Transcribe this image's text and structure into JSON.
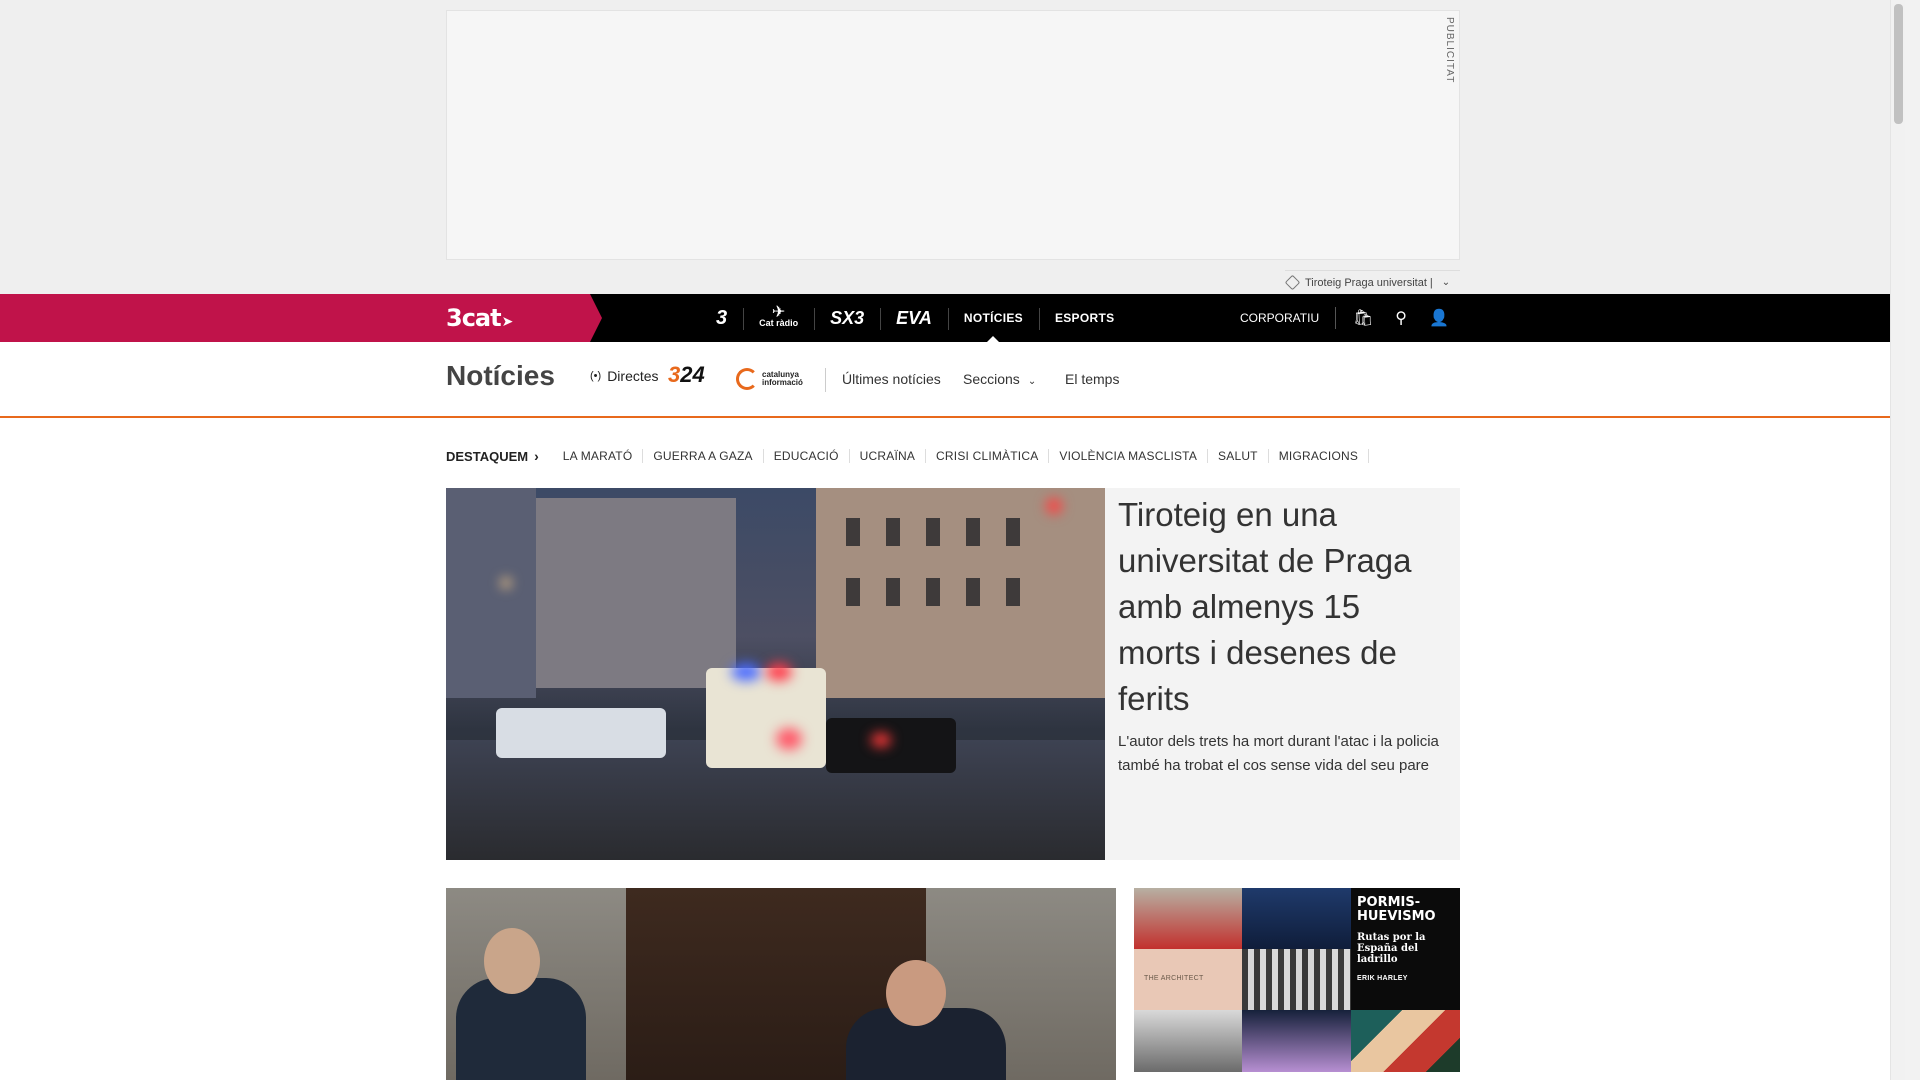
{
  "ad": {
    "label": "PUBLICITAT"
  },
  "tagline": {
    "text": "Tiroteig Praga universitat |"
  },
  "topnav": {
    "brand": "3cat",
    "channels": [
      {
        "label": "3"
      },
      {
        "label": "Cat ràdio"
      },
      {
        "label": "SX3"
      },
      {
        "label": "EVA"
      },
      {
        "label": "NOTÍCIES"
      },
      {
        "label": "ESPORTS"
      }
    ],
    "corporate": "CORPORATIU"
  },
  "section": {
    "title": "Notícies",
    "directes": "Directes",
    "logo_324": {
      "a": "3",
      "b": "24"
    },
    "logo_ci": {
      "line1": "catalunya",
      "line2": "informació"
    },
    "links": [
      "Últimes notícies",
      "Seccions",
      "El temps"
    ]
  },
  "destaquem": {
    "heading": "DESTAQUEM",
    "tags": [
      "LA MARATÓ",
      "GUERRA A GAZA",
      "EDUCACIÓ",
      "UCRAÏNA",
      "CRISI CLIMÀTICA",
      "VIOLÈNCIA MASCLISTA",
      "SALUT",
      "MIGRACIONS"
    ]
  },
  "hero": {
    "title": "Tiroteig en una universitat de Praga amb almenys 15 morts i desenes de ferits",
    "subtitle": "L'autor dels trets ha mort durant l'atac i la policia també ha trobat el cos sense vida del seu pare"
  },
  "promo": {
    "title": "PORMIS-HUEVISMO",
    "subtitle": "Rutas por la España del ladrillo",
    "author": "ERIK HARLEY",
    "tile_label": "THE ARCHITECT"
  },
  "colors": {
    "brand": "#c0134a",
    "accent": "#e8691c",
    "nav": "#000000"
  }
}
